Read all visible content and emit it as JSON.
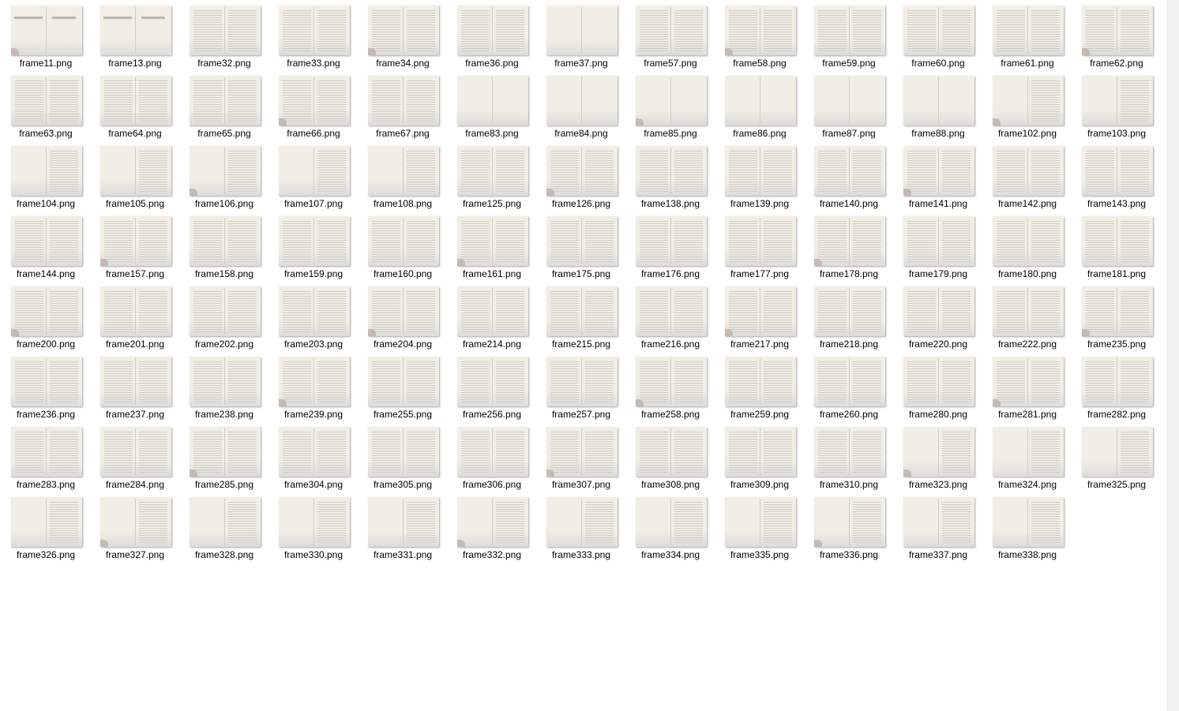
{
  "files": [
    {
      "name": "frame11.png",
      "style": "title"
    },
    {
      "name": "frame13.png",
      "style": "title"
    },
    {
      "name": "frame32.png",
      "style": "text"
    },
    {
      "name": "frame33.png",
      "style": "text"
    },
    {
      "name": "frame34.png",
      "style": "text"
    },
    {
      "name": "frame36.png",
      "style": "text"
    },
    {
      "name": "frame37.png",
      "style": "blank"
    },
    {
      "name": "frame57.png",
      "style": "text"
    },
    {
      "name": "frame58.png",
      "style": "text"
    },
    {
      "name": "frame59.png",
      "style": "text"
    },
    {
      "name": "frame60.png",
      "style": "text"
    },
    {
      "name": "frame61.png",
      "style": "text"
    },
    {
      "name": "frame62.png",
      "style": "text"
    },
    {
      "name": "frame63.png",
      "style": "text"
    },
    {
      "name": "frame64.png",
      "style": "text"
    },
    {
      "name": "frame65.png",
      "style": "text"
    },
    {
      "name": "frame66.png",
      "style": "text"
    },
    {
      "name": "frame67.png",
      "style": "text"
    },
    {
      "name": "frame83.png",
      "style": "blank"
    },
    {
      "name": "frame84.png",
      "style": "blank"
    },
    {
      "name": "frame85.png",
      "style": "blank"
    },
    {
      "name": "frame86.png",
      "style": "blank"
    },
    {
      "name": "frame87.png",
      "style": "blank"
    },
    {
      "name": "frame88.png",
      "style": "blank"
    },
    {
      "name": "frame102.png",
      "style": "right"
    },
    {
      "name": "frame103.png",
      "style": "right"
    },
    {
      "name": "frame104.png",
      "style": "right"
    },
    {
      "name": "frame105.png",
      "style": "right"
    },
    {
      "name": "frame106.png",
      "style": "right"
    },
    {
      "name": "frame107.png",
      "style": "right"
    },
    {
      "name": "frame108.png",
      "style": "right"
    },
    {
      "name": "frame125.png",
      "style": "text"
    },
    {
      "name": "frame126.png",
      "style": "text"
    },
    {
      "name": "frame138.png",
      "style": "text"
    },
    {
      "name": "frame139.png",
      "style": "text"
    },
    {
      "name": "frame140.png",
      "style": "text"
    },
    {
      "name": "frame141.png",
      "style": "text"
    },
    {
      "name": "frame142.png",
      "style": "text"
    },
    {
      "name": "frame143.png",
      "style": "text"
    },
    {
      "name": "frame144.png",
      "style": "text"
    },
    {
      "name": "frame157.png",
      "style": "text"
    },
    {
      "name": "frame158.png",
      "style": "text"
    },
    {
      "name": "frame159.png",
      "style": "text"
    },
    {
      "name": "frame160.png",
      "style": "text"
    },
    {
      "name": "frame161.png",
      "style": "text"
    },
    {
      "name": "frame175.png",
      "style": "text"
    },
    {
      "name": "frame176.png",
      "style": "text"
    },
    {
      "name": "frame177.png",
      "style": "text"
    },
    {
      "name": "frame178.png",
      "style": "text"
    },
    {
      "name": "frame179.png",
      "style": "text"
    },
    {
      "name": "frame180.png",
      "style": "text"
    },
    {
      "name": "frame181.png",
      "style": "text"
    },
    {
      "name": "frame200.png",
      "style": "text"
    },
    {
      "name": "frame201.png",
      "style": "text"
    },
    {
      "name": "frame202.png",
      "style": "text"
    },
    {
      "name": "frame203.png",
      "style": "text"
    },
    {
      "name": "frame204.png",
      "style": "text"
    },
    {
      "name": "frame214.png",
      "style": "text"
    },
    {
      "name": "frame215.png",
      "style": "text"
    },
    {
      "name": "frame216.png",
      "style": "text"
    },
    {
      "name": "frame217.png",
      "style": "text"
    },
    {
      "name": "frame218.png",
      "style": "text"
    },
    {
      "name": "frame220.png",
      "style": "text"
    },
    {
      "name": "frame222.png",
      "style": "text"
    },
    {
      "name": "frame235.png",
      "style": "text"
    },
    {
      "name": "frame236.png",
      "style": "text"
    },
    {
      "name": "frame237.png",
      "style": "text"
    },
    {
      "name": "frame238.png",
      "style": "text"
    },
    {
      "name": "frame239.png",
      "style": "text"
    },
    {
      "name": "frame255.png",
      "style": "text"
    },
    {
      "name": "frame256.png",
      "style": "text"
    },
    {
      "name": "frame257.png",
      "style": "text"
    },
    {
      "name": "frame258.png",
      "style": "text"
    },
    {
      "name": "frame259.png",
      "style": "text"
    },
    {
      "name": "frame260.png",
      "style": "text"
    },
    {
      "name": "frame280.png",
      "style": "text"
    },
    {
      "name": "frame281.png",
      "style": "text"
    },
    {
      "name": "frame282.png",
      "style": "text"
    },
    {
      "name": "frame283.png",
      "style": "text"
    },
    {
      "name": "frame284.png",
      "style": "text"
    },
    {
      "name": "frame285.png",
      "style": "text"
    },
    {
      "name": "frame304.png",
      "style": "text"
    },
    {
      "name": "frame305.png",
      "style": "text"
    },
    {
      "name": "frame306.png",
      "style": "text"
    },
    {
      "name": "frame307.png",
      "style": "text"
    },
    {
      "name": "frame308.png",
      "style": "text"
    },
    {
      "name": "frame309.png",
      "style": "text"
    },
    {
      "name": "frame310.png",
      "style": "text"
    },
    {
      "name": "frame323.png",
      "style": "right"
    },
    {
      "name": "frame324.png",
      "style": "right"
    },
    {
      "name": "frame325.png",
      "style": "right"
    },
    {
      "name": "frame326.png",
      "style": "right"
    },
    {
      "name": "frame327.png",
      "style": "right"
    },
    {
      "name": "frame328.png",
      "style": "right"
    },
    {
      "name": "frame330.png",
      "style": "right"
    },
    {
      "name": "frame331.png",
      "style": "right"
    },
    {
      "name": "frame332.png",
      "style": "right"
    },
    {
      "name": "frame333.png",
      "style": "right"
    },
    {
      "name": "frame334.png",
      "style": "right"
    },
    {
      "name": "frame335.png",
      "style": "right"
    },
    {
      "name": "frame336.png",
      "style": "right"
    },
    {
      "name": "frame337.png",
      "style": "right"
    },
    {
      "name": "frame338.png",
      "style": "right"
    }
  ]
}
